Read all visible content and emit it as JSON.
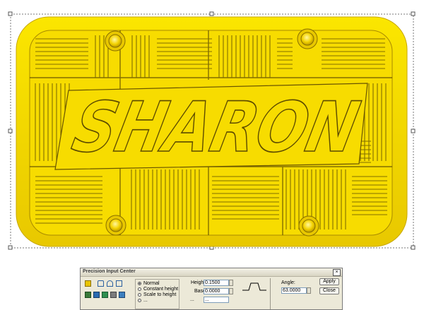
{
  "plate": {
    "text": "SHARON",
    "fill_color": "#f7dc00",
    "edge_color": "#e6c200",
    "line_color": "#7a6400"
  },
  "panel": {
    "title": "Precision Input Center",
    "close_symbol": "×",
    "radio_options": [
      {
        "label": "Normal",
        "selected": true
      },
      {
        "label": "Constant height",
        "selected": false
      },
      {
        "label": "Scale to height",
        "selected": false
      },
      {
        "label": "...",
        "selected": false
      }
    ],
    "height_label": "Height:",
    "height_value": "0.1500",
    "base_label": "Base:",
    "base_value": "0.0000",
    "third_label": "...",
    "third_value": "...",
    "angle_label": "Angle:",
    "angle_value": "63.0000",
    "apply_label": "Apply",
    "close_label": "Close",
    "tool_icons": [
      "swatch-icon",
      "shape-a-icon",
      "shape-b-icon",
      "shape-c-icon",
      "tool-a-icon",
      "tool-b-icon",
      "tool-c-icon",
      "tool-d-icon",
      "tool-e-icon"
    ]
  }
}
